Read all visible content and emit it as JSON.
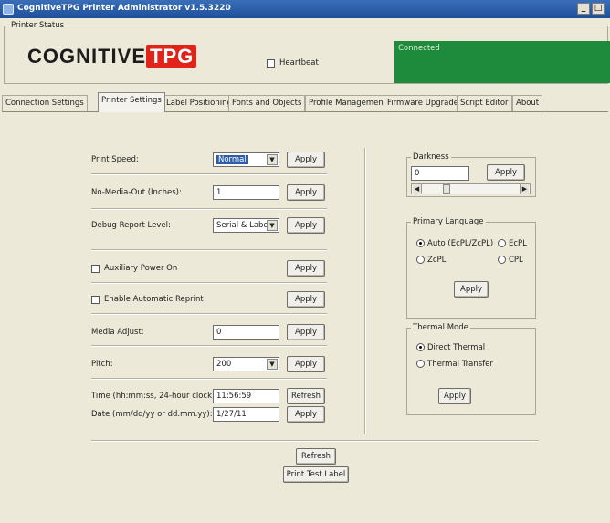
{
  "window": {
    "title": "CognitiveTPG Printer Administrator v1.5.3220",
    "controls": {
      "minimize": "_",
      "restore": "□"
    }
  },
  "printer_status": {
    "caption": "Printer Status",
    "logo": {
      "part1": "COGNITIVE",
      "part2": "TPG"
    },
    "heartbeat_label": "Heartbeat",
    "heartbeat_checked": false,
    "connection_text": "Connected",
    "connection_color": "#1e8a3c"
  },
  "tabs": [
    {
      "label": "Connection Settings",
      "active": false
    },
    {
      "label": "Printer Settings",
      "active": true
    },
    {
      "label": "Label Positioning",
      "active": false
    },
    {
      "label": "Fonts and Objects",
      "active": false
    },
    {
      "label": "Profile Management",
      "active": false
    },
    {
      "label": "Firmware Upgrade",
      "active": false
    },
    {
      "label": "Script Editor",
      "active": false
    },
    {
      "label": "About",
      "active": false
    }
  ],
  "settings": {
    "print_speed": {
      "label": "Print Speed:",
      "value": "Normal",
      "button": "Apply"
    },
    "no_media_out": {
      "label": "No-Media-Out (Inches):",
      "value": "1",
      "button": "Apply"
    },
    "debug_report": {
      "label": "Debug Report Level:",
      "value": "Serial & Label",
      "button": "Apply"
    },
    "aux_power": {
      "label": "Auxiliary Power On",
      "checked": false,
      "button": "Apply"
    },
    "auto_reprint": {
      "label": "Enable Automatic Reprint",
      "checked": false,
      "button": "Apply"
    },
    "media_adjust": {
      "label": "Media Adjust:",
      "value": "0",
      "button": "Apply"
    },
    "pitch": {
      "label": "Pitch:",
      "value": "200",
      "button": "Apply"
    },
    "time": {
      "label": "Time (hh:mm:ss, 24-hour clock):",
      "value": "11:56:59",
      "button": "Refresh"
    },
    "date": {
      "label": "Date (mm/dd/yy or dd.mm.yy):",
      "value": "1/27/11",
      "button": "Apply"
    }
  },
  "bottom": {
    "refresh": "Refresh",
    "print_test": "Print Test Label"
  },
  "darkness": {
    "caption": "Darkness",
    "value": "0",
    "button": "Apply"
  },
  "primary_language": {
    "caption": "Primary Language",
    "options": [
      "Auto (EcPL/ZcPL)",
      "EcPL",
      "ZcPL",
      "CPL"
    ],
    "selected": "Auto (EcPL/ZcPL)",
    "button": "Apply"
  },
  "thermal_mode": {
    "caption": "Thermal Mode",
    "options": [
      "Direct Thermal",
      "Thermal Transfer"
    ],
    "selected": "Direct Thermal",
    "button": "Apply"
  },
  "icons": {
    "dropdown": "▼",
    "scroll_left": "◀",
    "scroll_right": "▶"
  }
}
